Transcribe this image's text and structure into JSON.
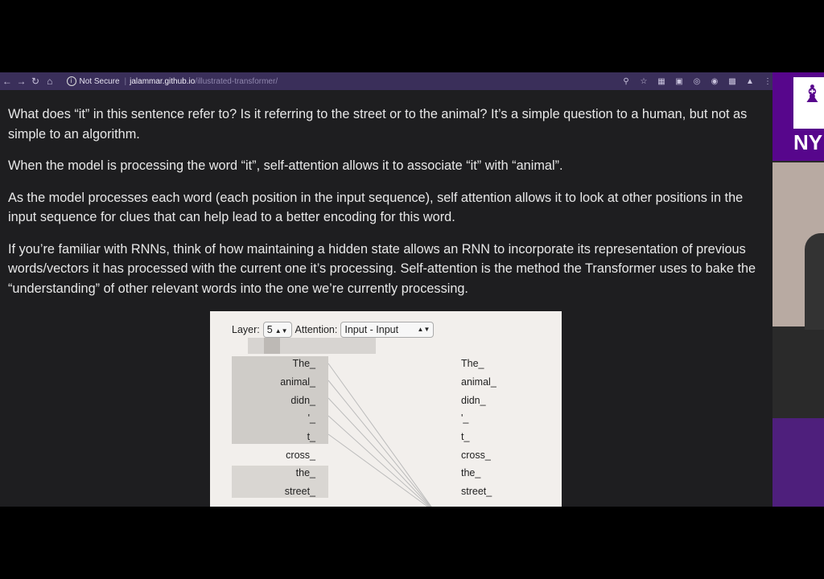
{
  "browser": {
    "security_label": "Not Secure",
    "url_host": "jalammar.github.io",
    "url_path": "/illustrated-transformer/"
  },
  "article": {
    "paragraphs": [
      "What does “it” in this sentence refer to? Is it referring to the street or to the animal? It’s a simple question to a human, but not as simple to an algorithm.",
      "When the model is processing the word “it”, self-attention allows it to associate “it” with “animal”.",
      "As the model processes each word (each position in the input sequence), self attention allows it to look at other positions in the input sequence for clues that can help lead to a better encoding for this word.",
      "If you’re familiar with RNNs, think of how maintaining a hidden state allows an RNN to incorporate its representation of previous words/vectors it has processed with the current one it’s processing. Self-attention is the method the Transformer uses to bake the “understanding” of other relevant words into the one we’re currently processing."
    ]
  },
  "widget": {
    "layer_label": "Layer:",
    "layer_value": "5",
    "attention_label": "Attention:",
    "attention_value": "Input - Input",
    "left_tokens": [
      "The_",
      "animal_",
      "didn_",
      "'_",
      "t_",
      "cross_",
      "the_",
      "street_"
    ],
    "right_tokens": [
      "The_",
      "animal_",
      "didn_",
      "'_",
      "t_",
      "cross_",
      "the_",
      "street_"
    ]
  },
  "sidebar": {
    "logo_text": "NY"
  }
}
